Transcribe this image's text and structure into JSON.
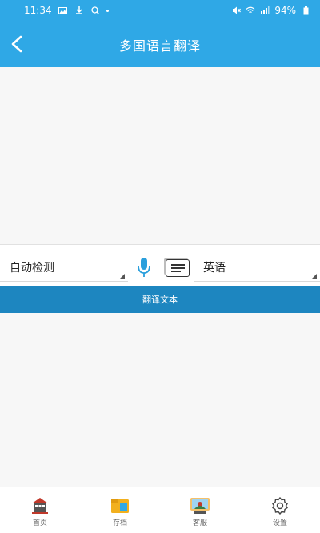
{
  "status_bar": {
    "time": "11:34",
    "battery": "94%"
  },
  "header": {
    "title": "多国语言翻译",
    "back_icon": "chevron-left-icon"
  },
  "source": {
    "text": ""
  },
  "language_bar": {
    "from": "自动检测",
    "to": "英语",
    "mic_icon": "microphone-icon",
    "doc_icon": "document-icon"
  },
  "translate_button": {
    "label": "翻译文本"
  },
  "output": {
    "text": ""
  },
  "tabs": [
    {
      "label": "首页",
      "icon": "home-icon"
    },
    {
      "label": "存档",
      "icon": "folder-icon"
    },
    {
      "label": "客服",
      "icon": "support-icon"
    },
    {
      "label": "设置",
      "icon": "gear-icon"
    }
  ],
  "colors": {
    "primary": "#2fa8e6",
    "button": "#1d86c0",
    "mic": "#2a9fdc"
  }
}
